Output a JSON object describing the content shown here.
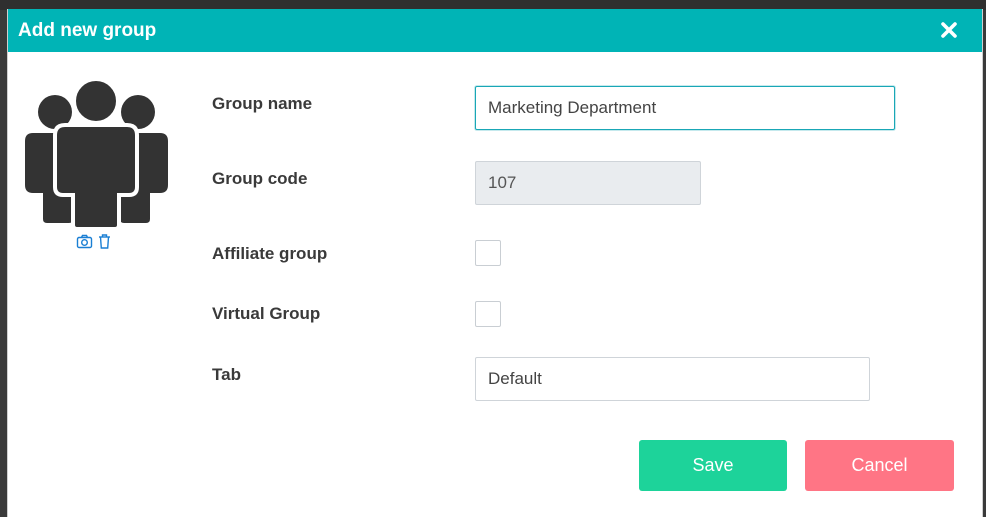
{
  "dialog": {
    "title": "Add new group"
  },
  "fields": {
    "group_name": {
      "label": "Group name",
      "value": "Marketing Department"
    },
    "group_code": {
      "label": "Group code",
      "value": "107"
    },
    "affiliate_group": {
      "label": "Affiliate group",
      "checked": false
    },
    "virtual_group": {
      "label": "Virtual Group",
      "checked": false
    },
    "tab": {
      "label": "Tab",
      "value": "Default"
    }
  },
  "actions": {
    "save_label": "Save",
    "cancel_label": "Cancel"
  },
  "icons": {
    "close": "close-icon",
    "avatar": "group-people-icon",
    "camera": "camera-icon",
    "trash": "trash-icon"
  },
  "colors": {
    "header": "#00b4b6",
    "save": "#1dd39a",
    "cancel": "#ff7585",
    "icon_blue": "#1a7fd4",
    "avatar": "#333333"
  }
}
